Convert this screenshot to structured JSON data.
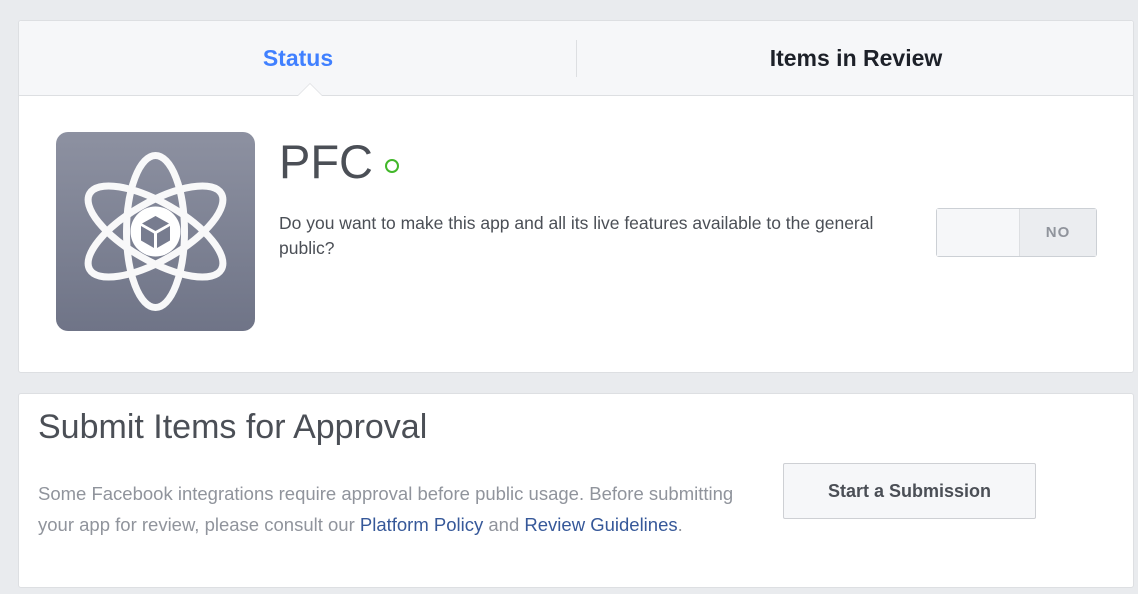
{
  "tabs": [
    {
      "label": "Status",
      "active": true
    },
    {
      "label": "Items in Review",
      "active": false
    }
  ],
  "app": {
    "name": "PFC",
    "icon": "atom-cube-icon",
    "status_indicator": "live-status-icon",
    "status_color": "#42b72a"
  },
  "public_toggle": {
    "question": "Do you want to make this app and all its live features available to the general public?",
    "state_label": "NO",
    "value": false
  },
  "submit": {
    "title": "Submit Items for Approval",
    "desc_text_1": "Some Facebook integrations require approval before public usage. Before submitting your app for review, please consult our ",
    "link_platform_policy": "Platform Policy",
    "desc_text_2": " and ",
    "link_review_guidelines": "Review Guidelines",
    "desc_text_3": ".",
    "button_label": "Start a Submission"
  },
  "colors": {
    "accent": "#4080ff",
    "link": "#365899",
    "background": "#e9ebee"
  }
}
